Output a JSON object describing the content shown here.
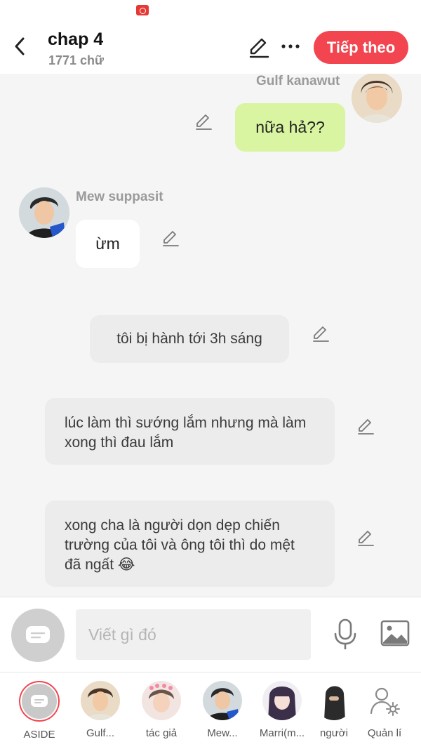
{
  "header": {
    "title": "chap 4",
    "word_count": "1771 chữ",
    "next_label": "Tiếp theo",
    "accent_color": "#f2454f"
  },
  "messages": [
    {
      "type": "right",
      "sender": "Gulf kanawut",
      "text": "nữa hả??",
      "bubble_color": "#d9f5a1"
    },
    {
      "type": "left",
      "sender": "Mew suppasit",
      "text": "ừm",
      "bubble_color": "#ffffff"
    },
    {
      "type": "narration",
      "text": "tôi bị hành tới 3h sáng"
    },
    {
      "type": "narration",
      "text": "lúc làm thì sướng lắm nhưng mà làm xong thì đau lắm"
    },
    {
      "type": "narration",
      "text": "xong cha là người dọn dẹp chiến trường của tôi và ông tôi thì do mệt đã ngất 😂"
    }
  ],
  "composer": {
    "placeholder": "Viết gì đó"
  },
  "characters": [
    {
      "label": "ASIDE"
    },
    {
      "label": "Gulf..."
    },
    {
      "label": "tác giả"
    },
    {
      "label": "Mew..."
    },
    {
      "label": "Marri(m..."
    },
    {
      "label": "người"
    },
    {
      "label": "Quản lí"
    }
  ]
}
